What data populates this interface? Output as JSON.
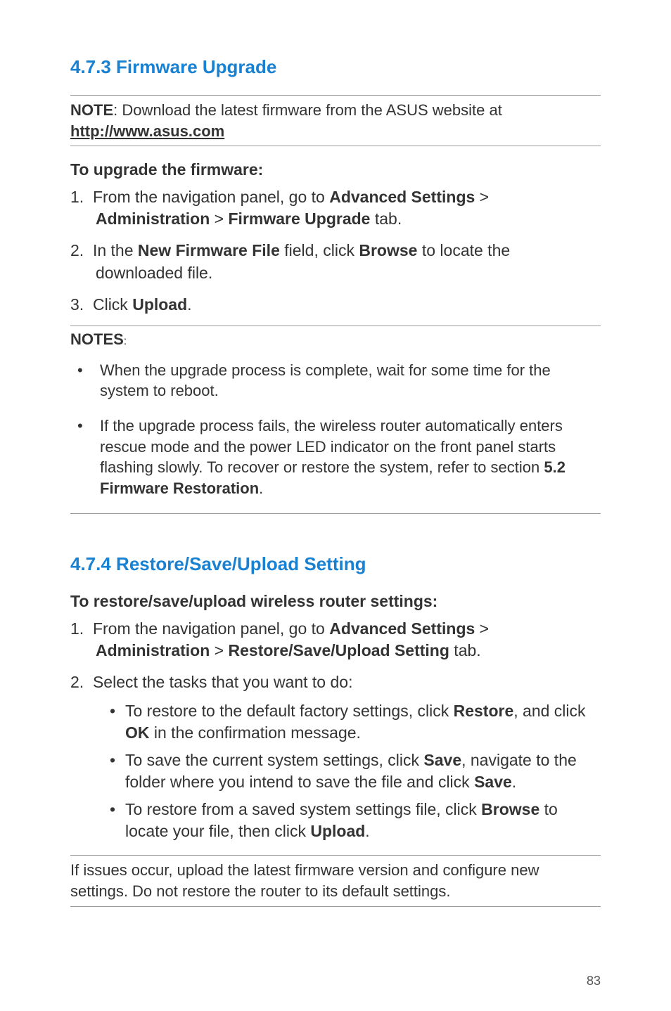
{
  "section1": {
    "heading": "4.7.3  Firmware Upgrade",
    "note_label": "NOTE",
    "note_text": ":  Download the latest firmware from the ASUS website at ",
    "note_link": "http://www.asus.com",
    "sub_heading": "To upgrade the firmware:",
    "steps": [
      {
        "num": "1.",
        "parts": [
          "From the navigation panel, go to ",
          "Advanced Settings",
          " > ",
          "Administration",
          " > ",
          "Firmware Upgrade",
          " tab."
        ]
      },
      {
        "num": "2.",
        "parts": [
          "In the ",
          "New Firmware File",
          " field, click ",
          "Browse",
          " to locate the downloaded file."
        ]
      },
      {
        "num": "3.",
        "parts": [
          "Click ",
          "Upload",
          "."
        ]
      }
    ],
    "notes_label": "NOTES",
    "notes_colon": ":",
    "notes": [
      {
        "parts": [
          "When the upgrade process is complete, wait for some time for the system to reboot."
        ]
      },
      {
        "parts": [
          "If the upgrade process fails, the wireless router automatically enters rescue mode and the power LED indicator on the front panel starts flashing slowly. To recover or restore the system, refer to section ",
          "5.2 Firmware Restoration",
          "."
        ]
      }
    ]
  },
  "section2": {
    "heading": "4.7.4  Restore/Save/Upload Setting",
    "sub_heading": "To restore/save/upload wireless router settings:",
    "steps": [
      {
        "num": "1.",
        "parts": [
          "From the navigation panel, go to ",
          "Advanced Settings",
          " > ",
          "Administration",
          " > ",
          "Restore/Save/Upload Setting",
          " tab."
        ]
      },
      {
        "num": "2.",
        "parts": [
          "Select the tasks that you want to do:"
        ]
      }
    ],
    "nested": [
      {
        "parts": [
          "To restore to the default factory settings, click ",
          "Restore",
          ", and click ",
          "OK",
          " in the confirmation message."
        ]
      },
      {
        "parts": [
          "To save the current system settings, click ",
          "Save",
          ", navigate to the folder where you intend to save the file and click ",
          "Save",
          "."
        ]
      },
      {
        "parts": [
          "To restore from a saved system settings file, click ",
          "Browse",
          " to locate your file, then click ",
          "Upload",
          "."
        ]
      }
    ],
    "footer": "If issues occur, upload the latest firmware version and configure new settings. Do not restore the router to its default settings."
  },
  "page_number": "83"
}
